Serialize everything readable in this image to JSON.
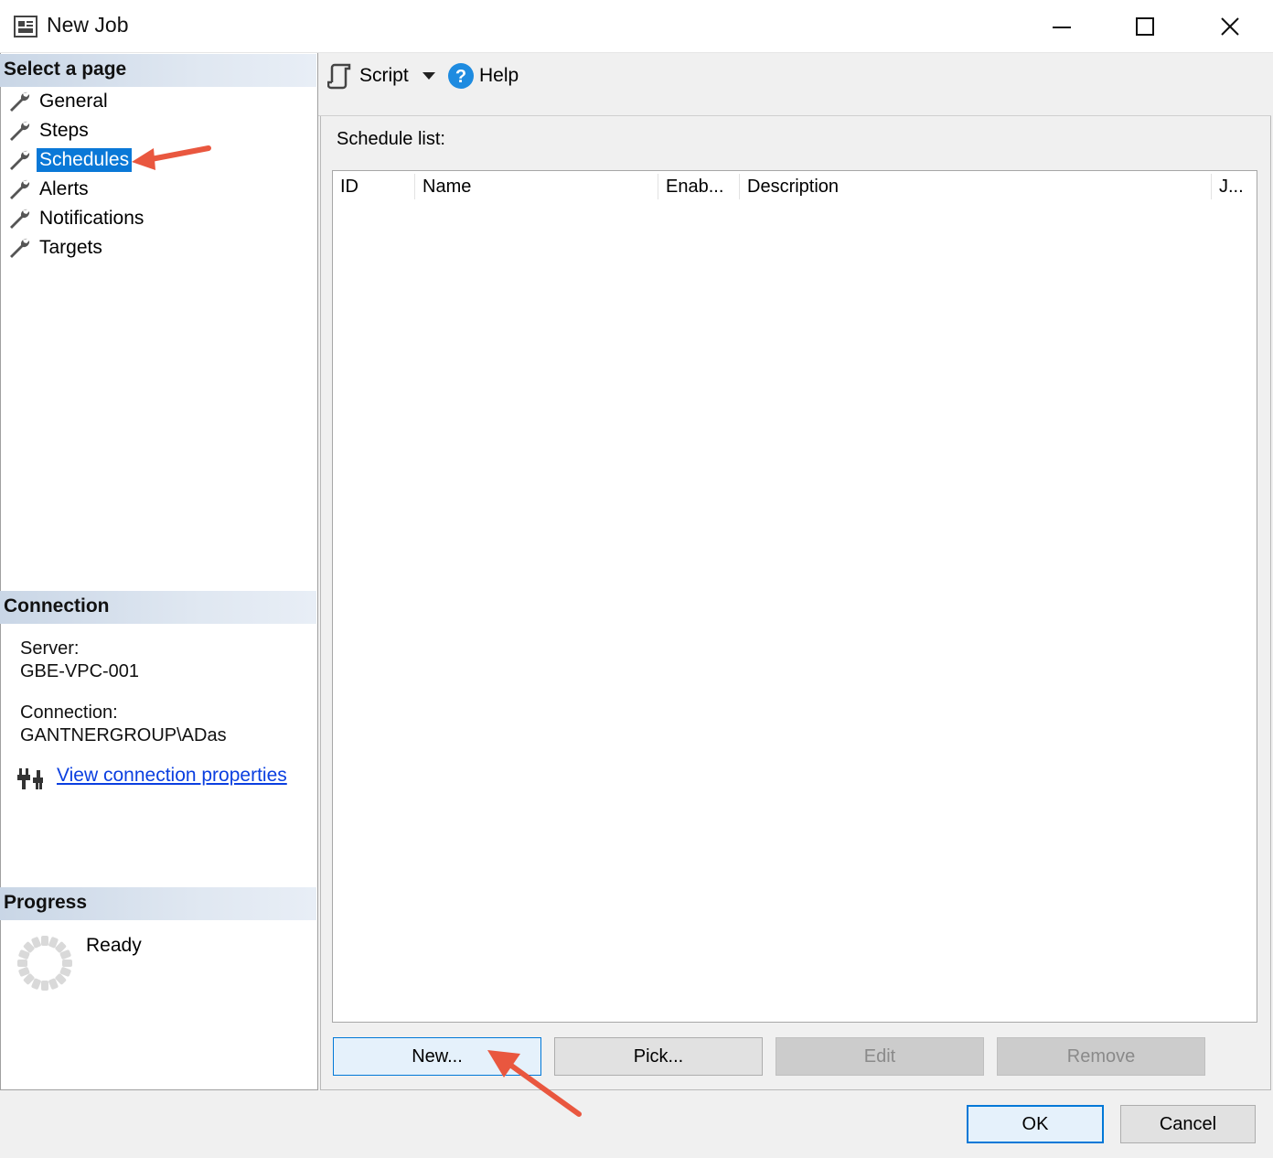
{
  "window": {
    "title": "New Job",
    "controls": {
      "minimize": "minimize-icon",
      "maximize": "maximize-icon",
      "close": "close-icon"
    }
  },
  "left": {
    "select_page_header": "Select a page",
    "pages": [
      {
        "label": "General",
        "icon": "wrench-icon",
        "selected": false
      },
      {
        "label": "Steps",
        "icon": "wrench-icon",
        "selected": false
      },
      {
        "label": "Schedules",
        "icon": "wrench-icon",
        "selected": true
      },
      {
        "label": "Alerts",
        "icon": "wrench-icon",
        "selected": false
      },
      {
        "label": "Notifications",
        "icon": "wrench-icon",
        "selected": false
      },
      {
        "label": "Targets",
        "icon": "wrench-icon",
        "selected": false
      }
    ],
    "connection_header": "Connection",
    "server_label": "Server:",
    "server_value": "GBE-VPC-001",
    "connection_label": "Connection:",
    "connection_value": "GANTNERGROUP\\ADas",
    "view_connection_link": "View connection properties",
    "progress_header": "Progress",
    "progress_status": "Ready"
  },
  "toolbar": {
    "script_label": "Script",
    "help_label": "Help"
  },
  "schedules": {
    "list_label": "Schedule list:",
    "columns": [
      "ID",
      "Name",
      "Enab...",
      "Description",
      "J..."
    ],
    "rows": []
  },
  "buttons": {
    "new": "New...",
    "pick": "Pick...",
    "edit": "Edit",
    "remove": "Remove",
    "ok": "OK",
    "cancel": "Cancel"
  },
  "colors": {
    "selection": "#0a78d7",
    "link": "#0b3fe0",
    "annotation_arrow": "#e9573f",
    "header_gradient": "#c9d6e6"
  }
}
